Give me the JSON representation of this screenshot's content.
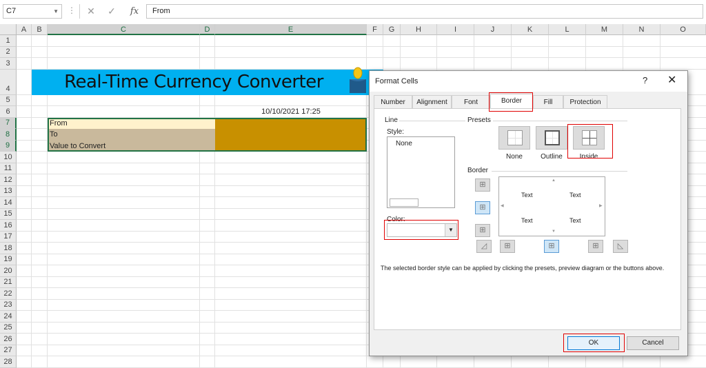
{
  "formula_bar": {
    "name_box": "C7",
    "cancel_glyph": "✕",
    "enter_glyph": "✓",
    "fx_label": "fx",
    "content": "From"
  },
  "columns": [
    "A",
    "B",
    "C",
    "D",
    "E",
    "F",
    "G",
    "H",
    "I",
    "J",
    "K",
    "L",
    "M",
    "N",
    "O"
  ],
  "rows": [
    "1",
    "2",
    "3",
    "4",
    "5",
    "6",
    "7",
    "8",
    "9",
    "10",
    "11",
    "12",
    "13",
    "14",
    "15",
    "16",
    "17",
    "18",
    "19",
    "20",
    "21",
    "22",
    "23",
    "24",
    "25",
    "26",
    "27",
    "28"
  ],
  "sheet": {
    "banner_title": "Real-Time Currency Converter",
    "timestamp": "10/10/2021 17:25",
    "labels": [
      "From",
      "To",
      "Value to Convert"
    ],
    "colors": {
      "banner": "#00b0f0",
      "label_row1": "#fff2cc",
      "label_rows": "#c9b99c",
      "value_fill": "#c89000"
    }
  },
  "dialog": {
    "title": "Format Cells",
    "help": "?",
    "close": "✕",
    "tabs": [
      "Number",
      "Alignment",
      "Font",
      "Border",
      "Fill",
      "Protection"
    ],
    "active_tab": "Border",
    "line_group": "Line",
    "style_label": "Style:",
    "style_none": "None",
    "color_label": "Color:",
    "presets_group": "Presets",
    "presets": [
      "None",
      "Outline",
      "Inside"
    ],
    "border_group": "Border",
    "preview_text": [
      "Text",
      "Text",
      "Text",
      "Text"
    ],
    "hint": "The selected border style can be applied by clicking the presets, preview diagram or the buttons above.",
    "ok": "OK",
    "cancel": "Cancel"
  }
}
